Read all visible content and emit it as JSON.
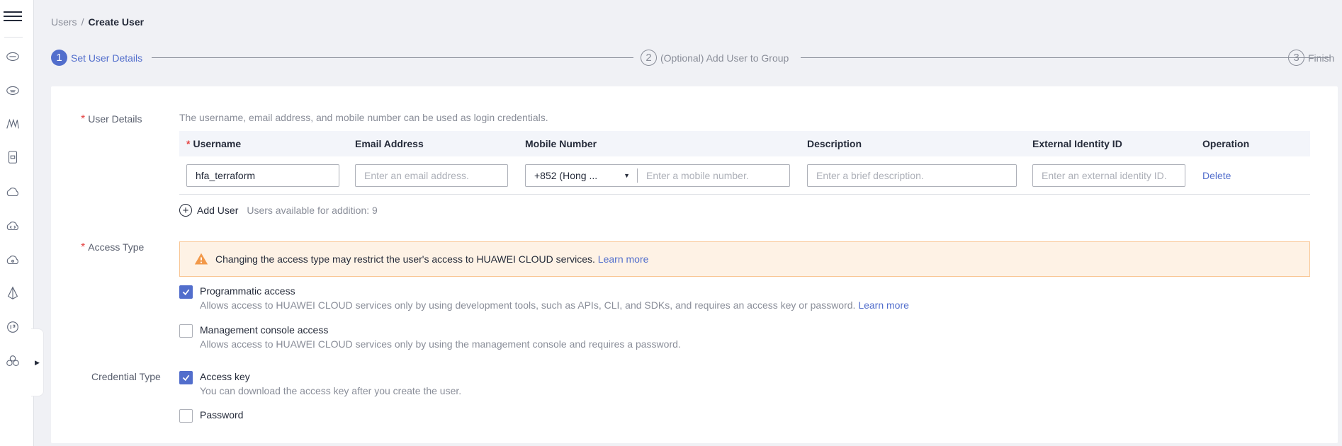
{
  "breadcrumb": {
    "parent": "Users",
    "separator": "/",
    "current": "Create User"
  },
  "steps": [
    {
      "num": "1",
      "label": "Set User Details"
    },
    {
      "num": "2",
      "label": "(Optional) Add User to Group"
    },
    {
      "num": "3",
      "label": "Finish"
    }
  ],
  "form": {
    "user_details": {
      "label": "User Details",
      "hint": "The username, email address, and mobile number can be used as login credentials.",
      "columns": {
        "username": "Username",
        "email": "Email Address",
        "mobile": "Mobile Number",
        "description": "Description",
        "external_id": "External Identity ID",
        "operation": "Operation"
      },
      "row": {
        "username_value": "hfa_terraform",
        "email_placeholder": "Enter an email address.",
        "country_code": "+852 (Hong ...",
        "mobile_placeholder": "Enter a mobile number.",
        "description_placeholder": "Enter a brief description.",
        "external_id_placeholder": "Enter an external identity ID.",
        "delete": "Delete"
      },
      "add_user": "Add User",
      "available": "Users available for addition: 9"
    },
    "access_type": {
      "label": "Access Type",
      "warning": "Changing the access type may restrict the user's access to HUAWEI CLOUD services.",
      "warning_link": "Learn more",
      "programmatic": {
        "title": "Programmatic access",
        "desc": "Allows access to HUAWEI CLOUD services only by using development tools, such as APIs, CLI, and SDKs, and requires an access key or password.",
        "link": "Learn more",
        "checked": true
      },
      "console": {
        "title": "Management console access",
        "desc": "Allows access to HUAWEI CLOUD services only by using the management console and requires a password.",
        "checked": false
      }
    },
    "credential_type": {
      "label": "Credential Type",
      "access_key": {
        "title": "Access key",
        "desc": "You can download the access key after you create the user.",
        "checked": true
      },
      "password": {
        "title": "Password",
        "checked": false
      }
    }
  },
  "colors": {
    "accent": "#526ecc",
    "required": "#e54545",
    "warning_bg": "#fef2e5",
    "warning_icon": "#f2994a"
  },
  "rail_icons": [
    "menu-icon",
    "cloud-icon",
    "cloud-server-icon",
    "mountain-icon",
    "phone-icon",
    "cloud-outline-icon",
    "cloud-code-icon",
    "cloud-dot-icon",
    "beacon-icon",
    "chat-circle-icon",
    "cluster-icon"
  ]
}
